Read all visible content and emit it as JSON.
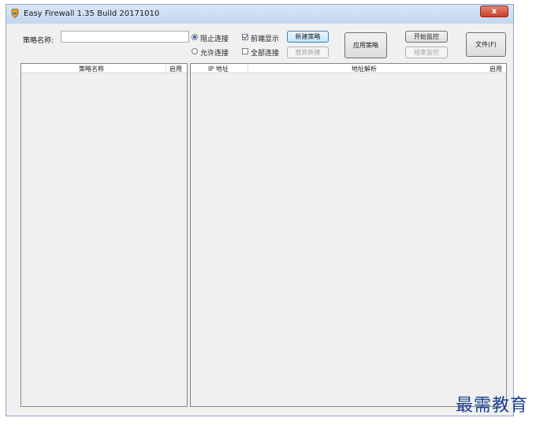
{
  "window": {
    "title": "Easy Firewall 1.35 Build 20171010",
    "close_label": "x"
  },
  "toolbar": {
    "policy_name_label": "策略名称:",
    "policy_name_value": "",
    "radio_block": "阻止连接",
    "radio_allow": "允许连接",
    "check_front": "前端显示",
    "check_all": "全部连接",
    "btn_new_policy": "新建策略",
    "btn_discard_new": "放弃新建",
    "btn_apply_policy": "应用策略",
    "btn_start_monitor": "开始监控",
    "btn_stop_monitor": "结束监控",
    "btn_file": "文件(F)"
  },
  "left_table": {
    "col_name": "策略名称",
    "col_enabled": "启用"
  },
  "right_table": {
    "col_ip": "IP 地址",
    "col_resolve": "地址解析",
    "col_enabled": "启用"
  },
  "watermark": "最需教育"
}
